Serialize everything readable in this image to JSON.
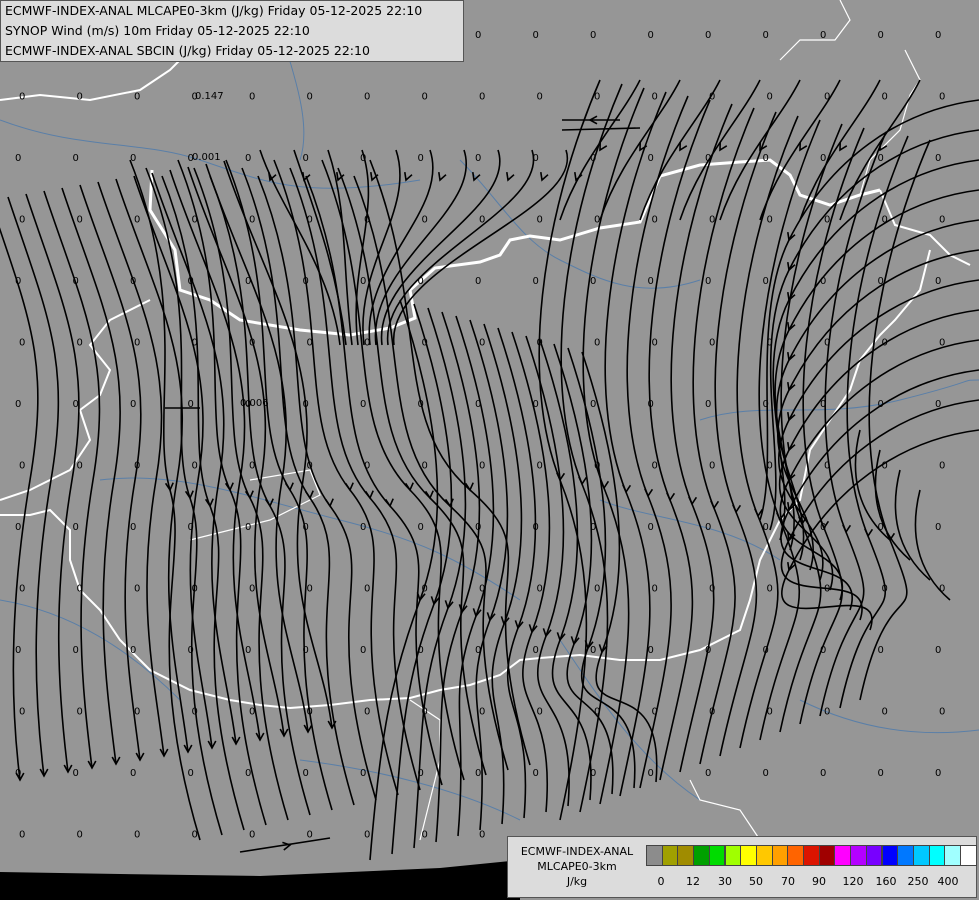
{
  "header": {
    "line1": "ECMWF-INDEX-ANAL MLCAPE0-3km (J/kg) Friday 05-12-2025 22:10",
    "line2": "SYNOP Wind (m/s) 10m Friday 05-12-2025 22:10",
    "line3": "ECMWF-INDEX-ANAL SBCIN (J/kg) Friday 05-12-2025 22:10"
  },
  "legend": {
    "title_line1": "ECMWF-INDEX-ANAL",
    "title_line2": "MLCAPE0-3km",
    "unit": "J/kg",
    "colors": [
      "#8c8c8c",
      "#a0a000",
      "#a08c00",
      "#00a000",
      "#00dc00",
      "#a0ff00",
      "#ffff00",
      "#ffc800",
      "#ffa000",
      "#ff6400",
      "#dc1400",
      "#a00000",
      "#ff00ff",
      "#b400ff",
      "#7800ff",
      "#0000ff",
      "#0078ff",
      "#00c8ff",
      "#00ffff",
      "#a0ffff",
      "#ffffff"
    ],
    "ticks": [
      "0",
      "12",
      "30",
      "50",
      "70",
      "90",
      "120",
      "160",
      "250",
      "400"
    ]
  },
  "special_values": [
    {
      "text": "0.147"
    },
    {
      "text": "0.001"
    },
    {
      "text": "0.006"
    }
  ],
  "grid_value": "0",
  "colors": {
    "background": "#969696",
    "streamline": "#000000",
    "border": "#ffffff",
    "river": "#5a7fa8"
  }
}
